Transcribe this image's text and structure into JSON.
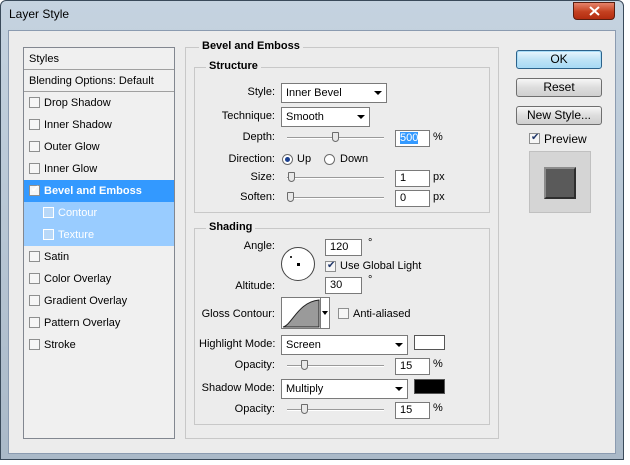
{
  "window": {
    "title": "Layer Style"
  },
  "sidebar": {
    "styles_label": "Styles",
    "blending_label": "Blending Options: Default",
    "items": [
      {
        "label": "Drop Shadow",
        "checked": false
      },
      {
        "label": "Inner Shadow",
        "checked": false
      },
      {
        "label": "Outer Glow",
        "checked": false
      },
      {
        "label": "Inner Glow",
        "checked": false
      },
      {
        "label": "Bevel and Emboss",
        "checked": true,
        "selected": true
      },
      {
        "label": "Contour",
        "checked": false,
        "sub": true
      },
      {
        "label": "Texture",
        "checked": false,
        "sub": true
      },
      {
        "label": "Satin",
        "checked": false
      },
      {
        "label": "Color Overlay",
        "checked": false
      },
      {
        "label": "Gradient Overlay",
        "checked": false
      },
      {
        "label": "Pattern Overlay",
        "checked": false
      },
      {
        "label": "Stroke",
        "checked": false
      }
    ]
  },
  "panel": {
    "title": "Bevel and Emboss",
    "structure": {
      "title": "Structure",
      "style_label": "Style:",
      "style_value": "Inner Bevel",
      "technique_label": "Technique:",
      "technique_value": "Smooth",
      "depth_label": "Depth:",
      "depth_value": "500",
      "depth_unit": "%",
      "depth_slider": 0.5,
      "direction_label": "Direction:",
      "direction_up": "Up",
      "direction_down": "Down",
      "direction_selected": "Up",
      "size_label": "Size:",
      "size_value": "1",
      "size_unit": "px",
      "size_slider": 0.01,
      "soften_label": "Soften:",
      "soften_value": "0",
      "soften_unit": "px",
      "soften_slider": 0.0
    },
    "shading": {
      "title": "Shading",
      "angle_label": "Angle:",
      "angle_value": "120",
      "angle_unit": "°",
      "use_global_light_label": "Use Global Light",
      "use_global_light": true,
      "altitude_label": "Altitude:",
      "altitude_value": "30",
      "altitude_unit": "°",
      "gloss_contour_label": "Gloss Contour:",
      "anti_aliased_label": "Anti-aliased",
      "anti_aliased": false,
      "highlight_mode_label": "Highlight Mode:",
      "highlight_mode_value": "Screen",
      "highlight_color": "#ffffff",
      "highlight_opacity_label": "Opacity:",
      "highlight_opacity_value": "15",
      "highlight_opacity_unit": "%",
      "highlight_opacity_slider": 0.15,
      "shadow_mode_label": "Shadow Mode:",
      "shadow_mode_value": "Multiply",
      "shadow_color": "#000000",
      "shadow_opacity_label": "Opacity:",
      "shadow_opacity_value": "15",
      "shadow_opacity_unit": "%",
      "shadow_opacity_slider": 0.15
    }
  },
  "buttons": {
    "ok": "OK",
    "reset": "Reset",
    "new_style": "New Style...",
    "preview_label": "Preview",
    "preview_checked": true
  },
  "colors": {
    "selected_row": "#3399ff",
    "sub_row": "#99ccff",
    "dialog_bg": "#ececec"
  }
}
